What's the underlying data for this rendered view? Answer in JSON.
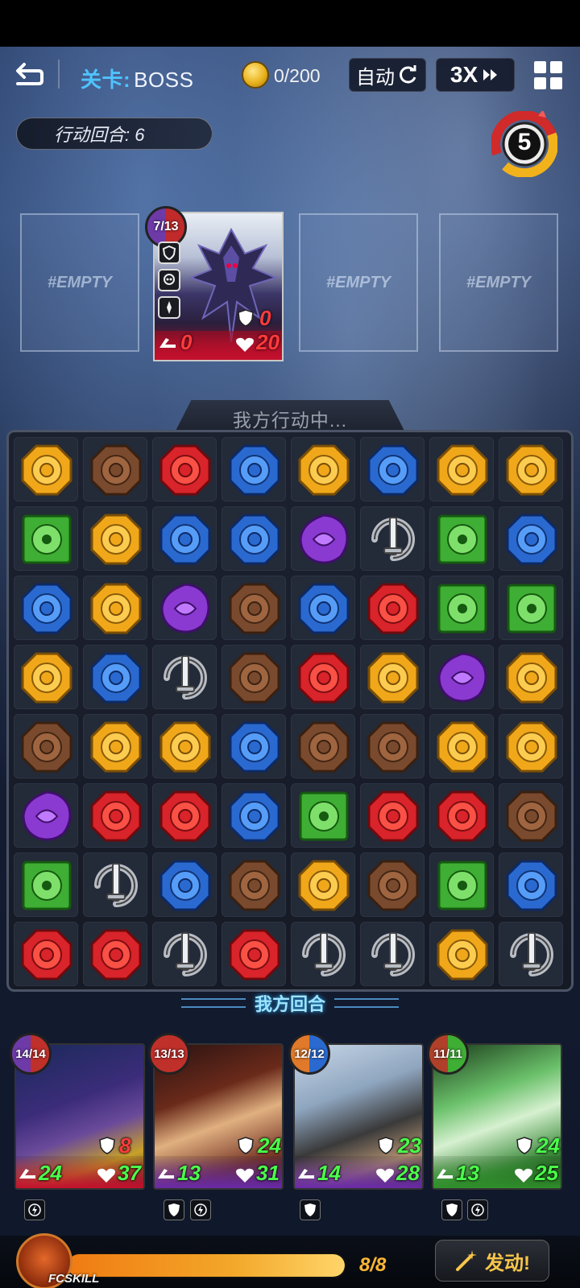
{
  "topbar": {
    "stage_label": "关卡:",
    "stage_value": "BOSS",
    "coins": "0/200",
    "auto_label": "自动",
    "speed_label": "3X"
  },
  "turn_pill": "行动回合: 6",
  "round_badge": "5",
  "enemy_slots": {
    "empty_label": "#EMPTY",
    "boss": {
      "counter": "7/13",
      "defense": "0",
      "attack": "0",
      "hp": "20"
    }
  },
  "board": {
    "status_text": "我方行动中...",
    "footer_text": "我方回合",
    "legend": {
      "Y": "sun-gem",
      "N": "earth-gem",
      "R": "fire-gem",
      "B": "water-gem",
      "G": "nature-gem",
      "P": "dark-gem",
      "S": "sword-gem"
    },
    "rows": [
      [
        "Y",
        "N",
        "R",
        "B",
        "Y",
        "B",
        "Y",
        "Y"
      ],
      [
        "G",
        "Y",
        "B",
        "B",
        "P",
        "S",
        "G",
        "B"
      ],
      [
        "B",
        "Y",
        "P",
        "N",
        "B",
        "R",
        "G",
        "G"
      ],
      [
        "Y",
        "B",
        "S",
        "N",
        "R",
        "Y",
        "P",
        "Y"
      ],
      [
        "N",
        "Y",
        "Y",
        "B",
        "N",
        "N",
        "Y",
        "Y"
      ],
      [
        "P",
        "R",
        "R",
        "B",
        "G",
        "R",
        "R",
        "N"
      ],
      [
        "G",
        "S",
        "B",
        "N",
        "Y",
        "N",
        "G",
        "B"
      ],
      [
        "R",
        "R",
        "S",
        "R",
        "S",
        "S",
        "Y",
        "S"
      ]
    ]
  },
  "heroes": [
    {
      "counter": "14/14",
      "defense": "8",
      "attack": "24",
      "hp": "37",
      "band_color": "#c4102e"
    },
    {
      "counter": "13/13",
      "defense": "24",
      "attack": "13",
      "hp": "31",
      "band_color": "#6a2aa8"
    },
    {
      "counter": "12/12",
      "defense": "23",
      "attack": "14",
      "hp": "28",
      "band_color": "#6a2aa8"
    },
    {
      "counter": "11/11",
      "defense": "24",
      "attack": "13",
      "hp": "25",
      "band_color": "#2f8f2a"
    }
  ],
  "fcskill": {
    "label": "FCSKILL",
    "count": "8/8",
    "fill_fraction": 1.0,
    "launch_label": "发动!"
  }
}
